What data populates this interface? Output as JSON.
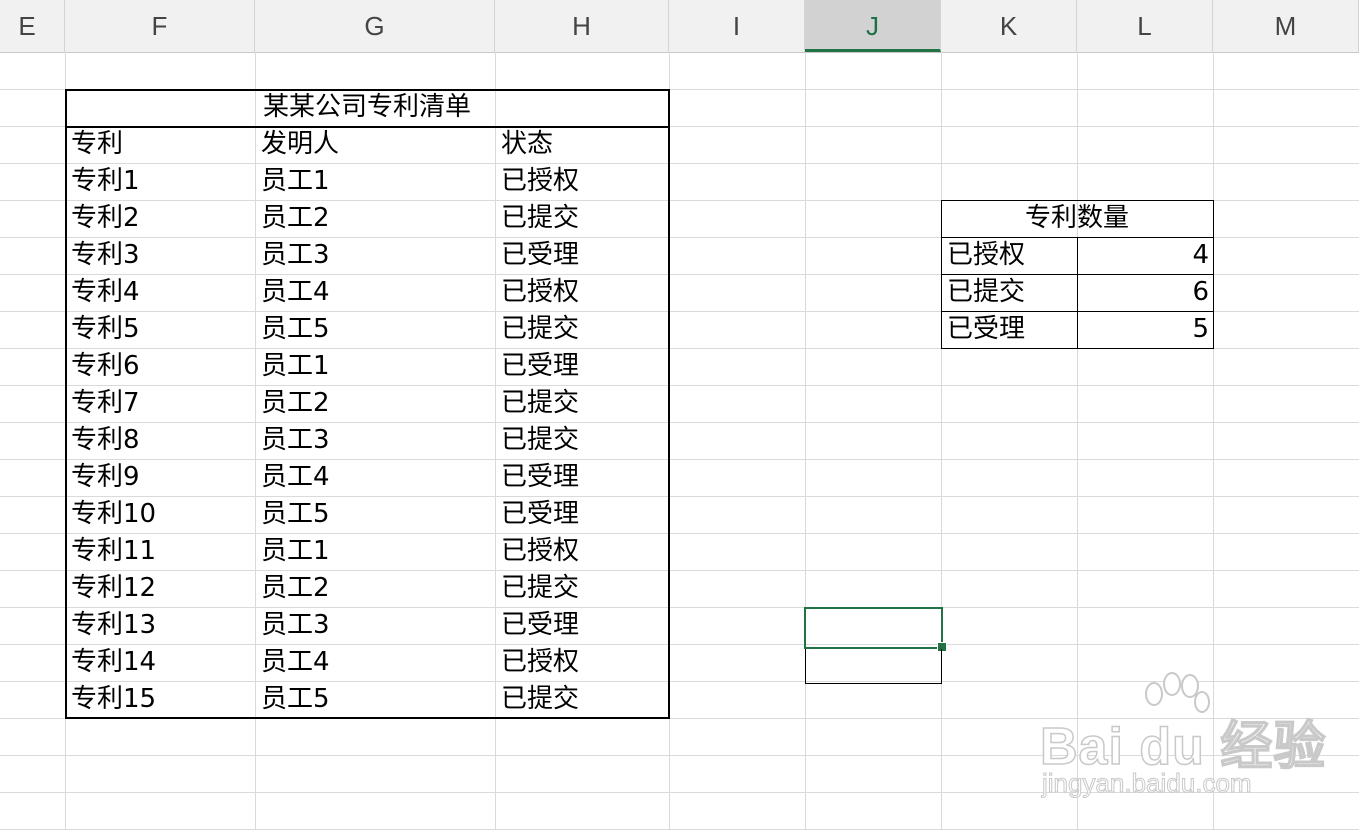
{
  "column_headers": [
    "E",
    "F",
    "G",
    "H",
    "I",
    "J",
    "K",
    "L",
    "M"
  ],
  "active_column": "J",
  "patent_table": {
    "title": "某某公司专利清单",
    "headers": [
      "专利",
      "发明人",
      "状态"
    ],
    "rows": [
      [
        "专利1",
        "员工1",
        "已授权"
      ],
      [
        "专利2",
        "员工2",
        "已提交"
      ],
      [
        "专利3",
        "员工3",
        "已受理"
      ],
      [
        "专利4",
        "员工4",
        "已授权"
      ],
      [
        "专利5",
        "员工5",
        "已提交"
      ],
      [
        "专利6",
        "员工1",
        "已受理"
      ],
      [
        "专利7",
        "员工2",
        "已提交"
      ],
      [
        "专利8",
        "员工3",
        "已提交"
      ],
      [
        "专利9",
        "员工4",
        "已受理"
      ],
      [
        "专利10",
        "员工5",
        "已受理"
      ],
      [
        "专利11",
        "员工1",
        "已授权"
      ],
      [
        "专利12",
        "员工2",
        "已提交"
      ],
      [
        "专利13",
        "员工3",
        "已受理"
      ],
      [
        "专利14",
        "员工4",
        "已授权"
      ],
      [
        "专利15",
        "员工5",
        "已提交"
      ]
    ]
  },
  "summary_table": {
    "title": "专利数量",
    "rows": [
      [
        "已授权",
        "4"
      ],
      [
        "已提交",
        "6"
      ],
      [
        "已受理",
        "5"
      ]
    ]
  },
  "watermark": {
    "main": "Bai du 经验",
    "sub": "jingyan.baidu.com"
  },
  "colors": {
    "accent": "#217346",
    "header_bg": "#f1f1f1",
    "grid": "#dadada"
  }
}
